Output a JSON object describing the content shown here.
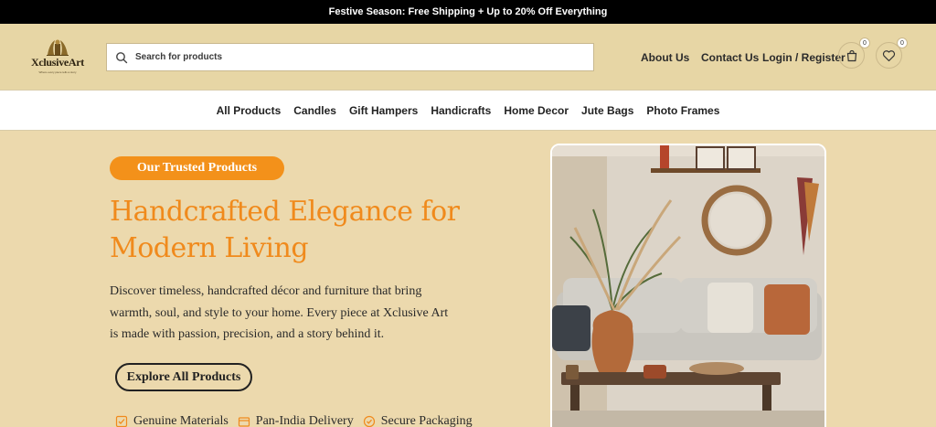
{
  "promo": {
    "text": "Festive Season: Free Shipping + Up to 20% Off Everything"
  },
  "header": {
    "logo": {
      "name": "XclusiveArt",
      "tagline": "Where every piece tells a story"
    },
    "search_placeholder": "Search for products",
    "links": {
      "about": "About Us",
      "contact": "Contact Us",
      "login": "Login / Register"
    },
    "cart_count": "0",
    "wishlist_count": "0"
  },
  "nav": {
    "items": [
      "All Products",
      "Candles",
      "Gift Hampers",
      "Handicrafts",
      "Home Decor",
      "Jute Bags",
      "Photo Frames"
    ]
  },
  "hero": {
    "badge": "Our Trusted Products",
    "title_line1": "Handcrafted Elegance for",
    "title_line2": "Modern Living",
    "description": "Discover timeless, handcrafted décor and furniture that bring warmth, soul, and style to your home. Every piece at Xclusive Art is made with passion, precision, and a story behind it.",
    "cta": "Explore All Products",
    "features": [
      "Genuine Materials",
      "Pan-India Delivery",
      "Secure Packaging"
    ]
  },
  "colors": {
    "accent": "#f3911a",
    "background": "#ecd9ad",
    "header": "#e7d6a5"
  }
}
